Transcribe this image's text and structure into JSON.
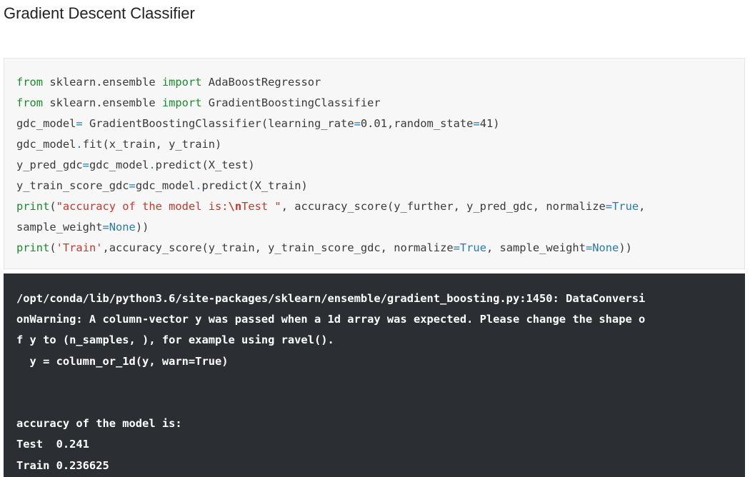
{
  "heading": "Gradient Descent Classifier",
  "code_lines": [
    [
      {
        "t": "from",
        "c": "kw"
      },
      {
        "t": " sklearn.ensemble ",
        "c": ""
      },
      {
        "t": "import",
        "c": "kw"
      },
      {
        "t": " AdaBoostRegressor",
        "c": ""
      }
    ],
    [
      {
        "t": "from",
        "c": "kw"
      },
      {
        "t": " sklearn.ensemble ",
        "c": ""
      },
      {
        "t": "import",
        "c": "kw"
      },
      {
        "t": " GradientBoostingClassifier",
        "c": ""
      }
    ],
    [
      {
        "t": "gdc_model",
        "c": ""
      },
      {
        "t": "=",
        "c": "op"
      },
      {
        "t": " GradientBoostingClassifier(learning_rate",
        "c": ""
      },
      {
        "t": "=",
        "c": "op"
      },
      {
        "t": "0.01",
        "c": "num"
      },
      {
        "t": ",random_state",
        "c": ""
      },
      {
        "t": "=",
        "c": "op"
      },
      {
        "t": "41)",
        "c": ""
      }
    ],
    [
      {
        "t": "gdc_model",
        "c": ""
      },
      {
        "t": ".",
        "c": "op"
      },
      {
        "t": "fit(x_train, y_train)",
        "c": ""
      }
    ],
    [
      {
        "t": "y_pred_gdc",
        "c": ""
      },
      {
        "t": "=",
        "c": "op"
      },
      {
        "t": "gdc_model",
        "c": ""
      },
      {
        "t": ".",
        "c": "op"
      },
      {
        "t": "predict(X_test)",
        "c": ""
      }
    ],
    [
      {
        "t": "y_train_score_gdc",
        "c": ""
      },
      {
        "t": "=",
        "c": "op"
      },
      {
        "t": "gdc_model",
        "c": ""
      },
      {
        "t": ".",
        "c": "op"
      },
      {
        "t": "predict(X_train)",
        "c": ""
      }
    ],
    [
      {
        "t": "print",
        "c": "kw"
      },
      {
        "t": "(",
        "c": ""
      },
      {
        "t": "\"accuracy of the model is:",
        "c": "str"
      },
      {
        "t": "\\n",
        "c": "esc"
      },
      {
        "t": "Test \"",
        "c": "str"
      },
      {
        "t": ", accuracy_score(y_further, y_pred_gdc, normalize",
        "c": ""
      },
      {
        "t": "=",
        "c": "op"
      },
      {
        "t": "True",
        "c": "bool"
      },
      {
        "t": ",",
        "c": ""
      }
    ],
    [
      {
        "t": "sample_weight",
        "c": ""
      },
      {
        "t": "=",
        "c": "op"
      },
      {
        "t": "None",
        "c": "bool"
      },
      {
        "t": "))",
        "c": ""
      }
    ],
    [
      {
        "t": "print",
        "c": "kw"
      },
      {
        "t": "(",
        "c": ""
      },
      {
        "t": "'Train'",
        "c": "str"
      },
      {
        "t": ",accuracy_score(y_train, y_train_score_gdc, normalize",
        "c": ""
      },
      {
        "t": "=",
        "c": "op"
      },
      {
        "t": "True",
        "c": "bool"
      },
      {
        "t": ", sample_weight",
        "c": ""
      },
      {
        "t": "=",
        "c": "op"
      },
      {
        "t": "None",
        "c": "bool"
      },
      {
        "t": "))",
        "c": ""
      }
    ]
  ],
  "output_lines": [
    "/opt/conda/lib/python3.6/site-packages/sklearn/ensemble/gradient_boosting.py:1450: DataConversi",
    "onWarning: A column-vector y was passed when a 1d array was expected. Please change the shape o",
    "f y to (n_samples, ), for example using ravel().",
    "  y = column_or_1d(y, warn=True)",
    "",
    "",
    "accuracy of the model is:",
    "Test  0.241",
    "Train 0.236625"
  ]
}
